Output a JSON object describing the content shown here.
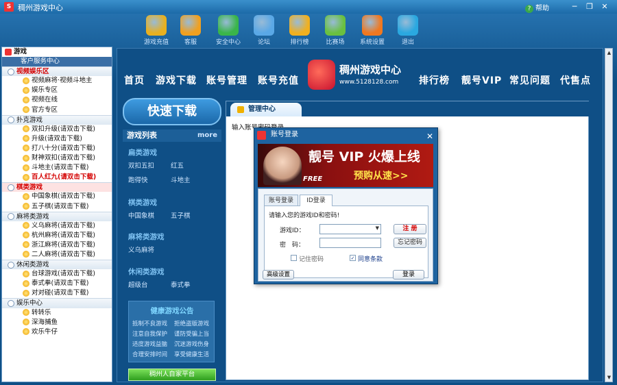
{
  "window": {
    "title": "稠州游戏中心",
    "help": "帮助",
    "min": "─",
    "max": "❐",
    "close": "✕"
  },
  "toolbar": {
    "items": [
      {
        "label": "游戏充值",
        "color": "#e8b020"
      },
      {
        "label": "客服",
        "color": "#f0a020"
      },
      {
        "label": "安全中心",
        "color": "#3ab54a"
      },
      {
        "label": "论坛",
        "color": "#5aa8e6"
      },
      {
        "label": "排行榜",
        "color": "#f0b020"
      },
      {
        "label": "比赛场",
        "color": "#6ac040"
      },
      {
        "label": "系统设置",
        "color": "#f07820"
      },
      {
        "label": "退出",
        "color": "#2aa8e0"
      }
    ]
  },
  "sidebar": {
    "root": "游戏",
    "rows": [
      {
        "label": "客户服务中心",
        "kind": "selected"
      },
      {
        "label": "视频娱乐区",
        "kind": "cat-red"
      },
      {
        "label": "视频麻将·视频斗地主",
        "kind": "leaf"
      },
      {
        "label": "娱乐专区",
        "kind": "leaf"
      },
      {
        "label": "视频在线",
        "kind": "leaf"
      },
      {
        "label": "官方专区",
        "kind": "leaf"
      },
      {
        "label": "扑克游戏",
        "kind": "cat"
      },
      {
        "label": "双扣升级(请双击下载)",
        "kind": "leaf"
      },
      {
        "label": "升级(请双击下载)",
        "kind": "leaf"
      },
      {
        "label": "打八十分(请双击下载)",
        "kind": "leaf"
      },
      {
        "label": "财神双扣(请双击下载)",
        "kind": "leaf"
      },
      {
        "label": "斗地主(请双击下载)",
        "kind": "leaf"
      },
      {
        "label": "百人红九(请双击下载)",
        "kind": "leaf-red"
      },
      {
        "label": "棋类游戏",
        "kind": "cat-hl"
      },
      {
        "label": "中国象棋(请双击下载)",
        "kind": "leaf"
      },
      {
        "label": "五子棋(请双击下载)",
        "kind": "leaf"
      },
      {
        "label": "麻将类游戏",
        "kind": "cat"
      },
      {
        "label": "义乌麻将(请双击下载)",
        "kind": "leaf"
      },
      {
        "label": "杭州麻将(请双击下载)",
        "kind": "leaf"
      },
      {
        "label": "浙江麻将(请双击下载)",
        "kind": "leaf"
      },
      {
        "label": "二人麻将(请双击下载)",
        "kind": "leaf"
      },
      {
        "label": "休闲类游戏",
        "kind": "cat"
      },
      {
        "label": "台球游戏(请双击下载)",
        "kind": "leaf"
      },
      {
        "label": "泰式拳(请双击下载)",
        "kind": "leaf"
      },
      {
        "label": "对对碰(请双击下载)",
        "kind": "leaf"
      },
      {
        "label": "娱乐中心",
        "kind": "cat"
      },
      {
        "label": "转转乐",
        "kind": "leaf"
      },
      {
        "label": "深海捕鱼",
        "kind": "leaf"
      },
      {
        "label": "欢乐牛仔",
        "kind": "leaf"
      }
    ]
  },
  "nav": {
    "items": [
      "首页",
      "游戏下载",
      "账号管理",
      "账号充值",
      "排行榜",
      "靓号VIP",
      "常见问题",
      "代售点"
    ]
  },
  "site": {
    "name": "稠州游戏中心",
    "url": "www.5128128.com"
  },
  "leftcol": {
    "quick_download": "快速下载",
    "list_title": "游戏列表",
    "more": "more",
    "sections": [
      {
        "title": "扁类游戏",
        "items": [
          "双扣五扣",
          "红五",
          "跑得快",
          "斗地主"
        ]
      },
      {
        "title": "棋类游戏",
        "items": [
          "中国象棋",
          "五子棋"
        ]
      },
      {
        "title": "麻将类游戏",
        "items": [
          "义乌麻将"
        ]
      },
      {
        "title": "休闲类游戏",
        "items": [
          "超级台",
          "泰式拳"
        ]
      }
    ],
    "notice_title": "健康游戏公告",
    "notice_lines": [
      "抵制不良游戏",
      "拒绝盗版游戏",
      "注意自我保护",
      "谨防受骗上当",
      "适度游戏益脑",
      "沉迷游戏伤身",
      "合理安排时间",
      "享受健康生活"
    ],
    "green_button": "稠州人自家平台"
  },
  "content": {
    "tab": "管理中心",
    "status": "输入账号密码登录"
  },
  "dialog": {
    "title": "账号登录",
    "close": "✕",
    "banner_vip": "靓号 VIP 火爆上线",
    "banner_cta": "预购从速>>",
    "banner_free": "FREE",
    "tabs": [
      "账号登录",
      "ID登录"
    ],
    "welcome": "请输入您的游戏ID和密码!",
    "id_label": "游戏ID：",
    "pwd_label": "密　码：",
    "register": "注 册",
    "forgot": "忘记密码",
    "remember_label": "记住密码",
    "protect_label": "同意条款",
    "advanced": "高级设置",
    "login": "登录"
  }
}
